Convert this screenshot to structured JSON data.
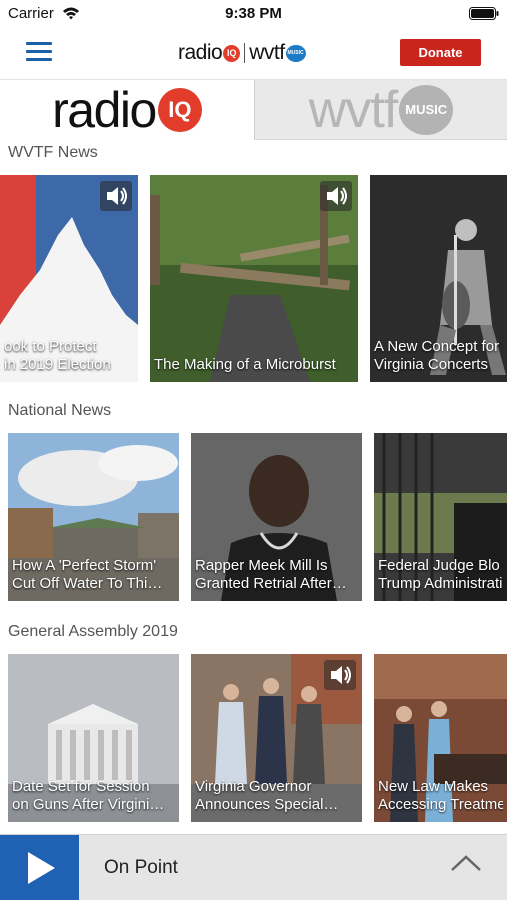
{
  "status_bar": {
    "carrier": "Carrier",
    "time": "9:38 PM",
    "icons": [
      "wifi-icon",
      "battery-icon"
    ]
  },
  "header": {
    "logo_radio": "radio",
    "logo_iq": "IQ",
    "logo_wvtf": "wvtf",
    "logo_music": "MUSIC",
    "donate_label": "Donate",
    "donate_color": "#c9251c",
    "menu_icon": "hamburger-menu-icon"
  },
  "station_tabs": {
    "radioiq": {
      "word": "radio",
      "badge": "IQ",
      "selected": true
    },
    "wvtf": {
      "word": "wvtf",
      "badge": "MUSIC",
      "selected": false
    }
  },
  "sections": [
    {
      "title": "WVTF News",
      "cards": [
        {
          "line1": "ook to Protect",
          "line2": "in 2019 Election",
          "audio": true
        },
        {
          "line1": "The Making of a Microburst",
          "line2": "",
          "audio": true
        },
        {
          "line1": "A New Concept for",
          "line2": "Virginia Concerts",
          "audio": false
        }
      ]
    },
    {
      "title": "National News",
      "cards": [
        {
          "line1": "How A 'Perfect Storm'",
          "line2": "Cut Off Water To Thi…",
          "audio": false
        },
        {
          "line1": "Rapper Meek Mill Is",
          "line2": "Granted Retrial After…",
          "audio": false
        },
        {
          "line1": "Federal Judge Blo",
          "line2": "Trump Administrati",
          "audio": false
        }
      ]
    },
    {
      "title": "General Assembly 2019",
      "cards": [
        {
          "line1": "Date Set for Session",
          "line2": "on Guns After Virgini…",
          "audio": false
        },
        {
          "line1": "Virginia Governor",
          "line2": "Announces Special…",
          "audio": true
        },
        {
          "line1": "New Law Makes",
          "line2": "Accessing Treatme",
          "audio": false
        }
      ]
    }
  ],
  "player": {
    "now_playing": "On Point",
    "accent": "#1f62b3",
    "icons": [
      "play-icon",
      "chevron-up-icon"
    ]
  }
}
